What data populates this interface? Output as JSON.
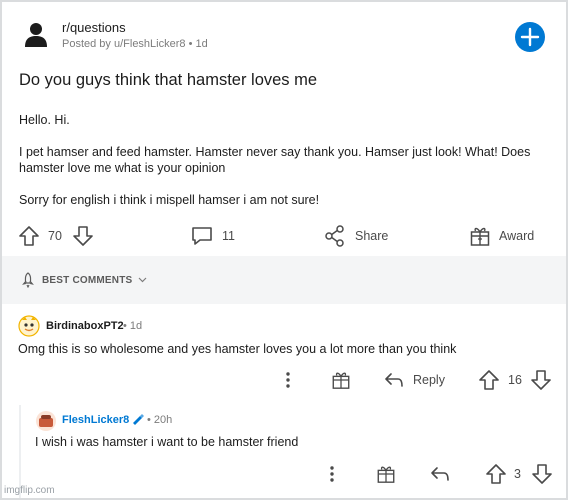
{
  "post": {
    "subreddit": "r/questions",
    "posted_by": "Posted by u/FleshLicker8 • 1d",
    "title": "Do you guys think that hamster loves me",
    "body": [
      "Hello. Hi.",
      "I pet hamser and feed hamster. Hamster never say thank you. Hamser just look! What! Does hamster love me what is your opinion",
      "Sorry for english i think i mispell hamser i am not sure!"
    ],
    "votes": "70",
    "comments": "11",
    "share_label": "Share",
    "award_label": "Award"
  },
  "sort": {
    "label": "BEST COMMENTS"
  },
  "comments": [
    {
      "author": "BirdinaboxPT2",
      "time": "• 1d",
      "text": "Omg this is so wholesome and yes hamster loves you a lot more than you think",
      "reply_label": "Reply",
      "votes": "16"
    },
    {
      "author": "FleshLicker8",
      "time": "• 20h",
      "text": "I wish i was hamster i want to be hamster friend",
      "votes": "3"
    }
  ],
  "watermark": "imgflip.com",
  "colors": {
    "accent": "#0079d3",
    "op_author": "#0079d3",
    "text": "#1c1c1c",
    "muted": "#7c7c7c"
  },
  "icons": [
    "user-avatar-icon",
    "plus-icon",
    "upvote-icon",
    "downvote-icon",
    "comment-icon",
    "share-icon",
    "award-icon",
    "rocket-icon",
    "chevron-down-icon",
    "more-icon",
    "reply-icon"
  ]
}
